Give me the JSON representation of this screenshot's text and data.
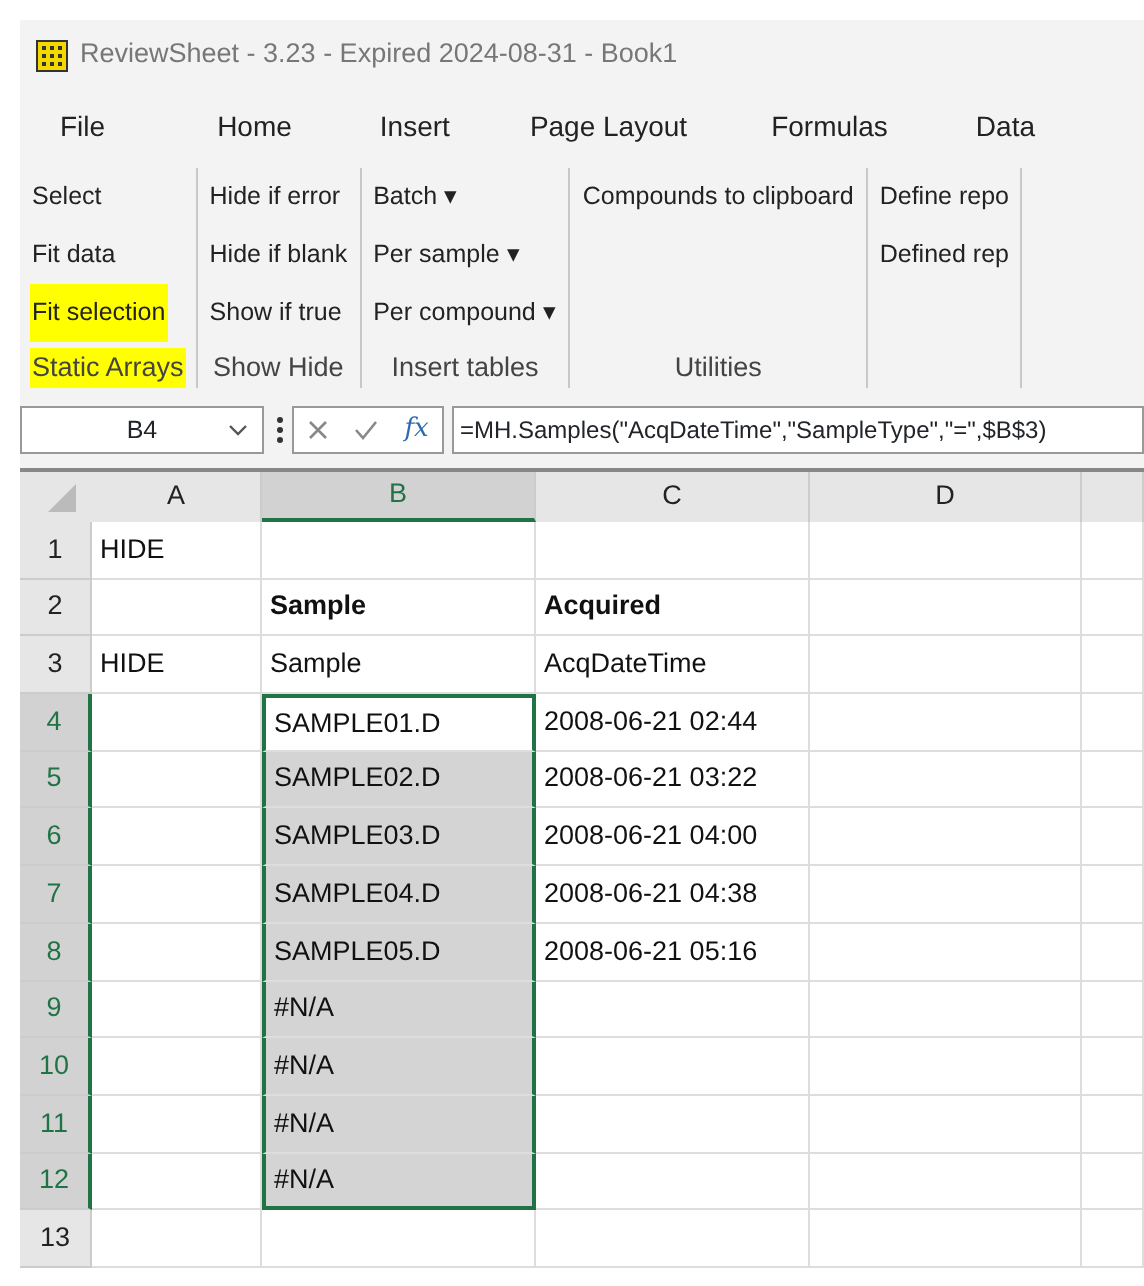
{
  "window": {
    "title": "ReviewSheet - 3.23 - Expired 2024-08-31 - Book1"
  },
  "menu_tabs": [
    {
      "label": "File"
    },
    {
      "label": "Home"
    },
    {
      "label": "Insert"
    },
    {
      "label": "Page Layout"
    },
    {
      "label": "Formulas"
    },
    {
      "label": "Data"
    }
  ],
  "ribbon_groups": [
    {
      "label": "Static Arrays",
      "highlighted": true,
      "items": [
        {
          "label": "Select",
          "highlighted": false
        },
        {
          "label": "Fit data",
          "highlighted": false
        },
        {
          "label": "Fit selection",
          "highlighted": true
        }
      ]
    },
    {
      "label": "Show Hide",
      "highlighted": false,
      "items": [
        {
          "label": "Hide if error",
          "highlighted": false
        },
        {
          "label": "Hide if blank",
          "highlighted": false
        },
        {
          "label": "Show if true",
          "highlighted": false
        }
      ]
    },
    {
      "label": "Insert tables",
      "highlighted": false,
      "items": [
        {
          "label": "Batch ▾",
          "highlighted": false
        },
        {
          "label": "Per sample ▾",
          "highlighted": false
        },
        {
          "label": "Per compound ▾",
          "highlighted": false
        }
      ]
    },
    {
      "label": "Utilities",
      "highlighted": false,
      "items": [
        {
          "label": "Compounds to clipboard",
          "highlighted": false
        }
      ]
    },
    {
      "items": [
        {
          "label": "Define repo",
          "highlighted": false
        },
        {
          "label": "Defined rep",
          "highlighted": false
        }
      ]
    }
  ],
  "formula_bar": {
    "name_box": "B4",
    "function_label": "fx",
    "formula": "=MH.Samples(\"AcqDateTime\",\"SampleType\",\"=\",$B$3)"
  },
  "columns": [
    {
      "label": "A",
      "selected": false
    },
    {
      "label": "B",
      "selected": true
    },
    {
      "label": "C",
      "selected": false
    },
    {
      "label": "D",
      "selected": false
    }
  ],
  "rows": [
    {
      "number": "1",
      "kind": "data",
      "selected": false,
      "cells": [
        {
          "text": "HIDE",
          "selected": false
        },
        {
          "text": "",
          "selected": false
        },
        {
          "text": "",
          "selected": false
        },
        {
          "text": "",
          "selected": false
        }
      ]
    },
    {
      "number": "2",
      "kind": "header",
      "selected": false,
      "cells": [
        {
          "text": "",
          "selected": false
        },
        {
          "text": "Sample",
          "selected": false
        },
        {
          "text": "Acquired",
          "selected": false
        },
        {
          "text": "",
          "selected": false
        }
      ]
    },
    {
      "number": "3",
      "kind": "data",
      "selected": false,
      "cells": [
        {
          "text": "HIDE",
          "selected": false
        },
        {
          "text": "Sample",
          "selected": false
        },
        {
          "text": "AcqDateTime",
          "selected": false
        },
        {
          "text": "",
          "selected": false
        }
      ]
    },
    {
      "number": "4",
      "kind": "data",
      "selected": true,
      "cells": [
        {
          "text": "",
          "selected": false
        },
        {
          "text": "SAMPLE01.D",
          "selected": true
        },
        {
          "text": "2008-06-21 02:44",
          "selected": false
        },
        {
          "text": "",
          "selected": false
        }
      ]
    },
    {
      "number": "5",
      "kind": "data",
      "selected": true,
      "cells": [
        {
          "text": "",
          "selected": false
        },
        {
          "text": "SAMPLE02.D",
          "selected": true
        },
        {
          "text": "2008-06-21 03:22",
          "selected": false
        },
        {
          "text": "",
          "selected": false
        }
      ]
    },
    {
      "number": "6",
      "kind": "data",
      "selected": true,
      "cells": [
        {
          "text": "",
          "selected": false
        },
        {
          "text": "SAMPLE03.D",
          "selected": true
        },
        {
          "text": "2008-06-21 04:00",
          "selected": false
        },
        {
          "text": "",
          "selected": false
        }
      ]
    },
    {
      "number": "7",
      "kind": "data",
      "selected": true,
      "cells": [
        {
          "text": "",
          "selected": false
        },
        {
          "text": "SAMPLE04.D",
          "selected": true
        },
        {
          "text": "2008-06-21 04:38",
          "selected": false
        },
        {
          "text": "",
          "selected": false
        }
      ]
    },
    {
      "number": "8",
      "kind": "data",
      "selected": true,
      "cells": [
        {
          "text": "",
          "selected": false
        },
        {
          "text": "SAMPLE05.D",
          "selected": true
        },
        {
          "text": "2008-06-21 05:16",
          "selected": false
        },
        {
          "text": "",
          "selected": false
        }
      ]
    },
    {
      "number": "9",
      "kind": "data",
      "selected": true,
      "cells": [
        {
          "text": "",
          "selected": false
        },
        {
          "text": "#N/A",
          "selected": true
        },
        {
          "text": "",
          "selected": false
        },
        {
          "text": "",
          "selected": false
        }
      ]
    },
    {
      "number": "10",
      "kind": "data",
      "selected": true,
      "cells": [
        {
          "text": "",
          "selected": false
        },
        {
          "text": "#N/A",
          "selected": true
        },
        {
          "text": "",
          "selected": false
        },
        {
          "text": "",
          "selected": false
        }
      ]
    },
    {
      "number": "11",
      "kind": "data",
      "selected": true,
      "cells": [
        {
          "text": "",
          "selected": false
        },
        {
          "text": "#N/A",
          "selected": true
        },
        {
          "text": "",
          "selected": false
        },
        {
          "text": "",
          "selected": false
        }
      ]
    },
    {
      "number": "12",
      "kind": "data",
      "selected": true,
      "cells": [
        {
          "text": "",
          "selected": false
        },
        {
          "text": "#N/A",
          "selected": true
        },
        {
          "text": "",
          "selected": false
        },
        {
          "text": "",
          "selected": false
        }
      ]
    },
    {
      "number": "13",
      "kind": "data",
      "selected": false,
      "cells": [
        {
          "text": "",
          "selected": false
        },
        {
          "text": "",
          "selected": false
        },
        {
          "text": "",
          "selected": false
        },
        {
          "text": "",
          "selected": false
        }
      ]
    }
  ]
}
